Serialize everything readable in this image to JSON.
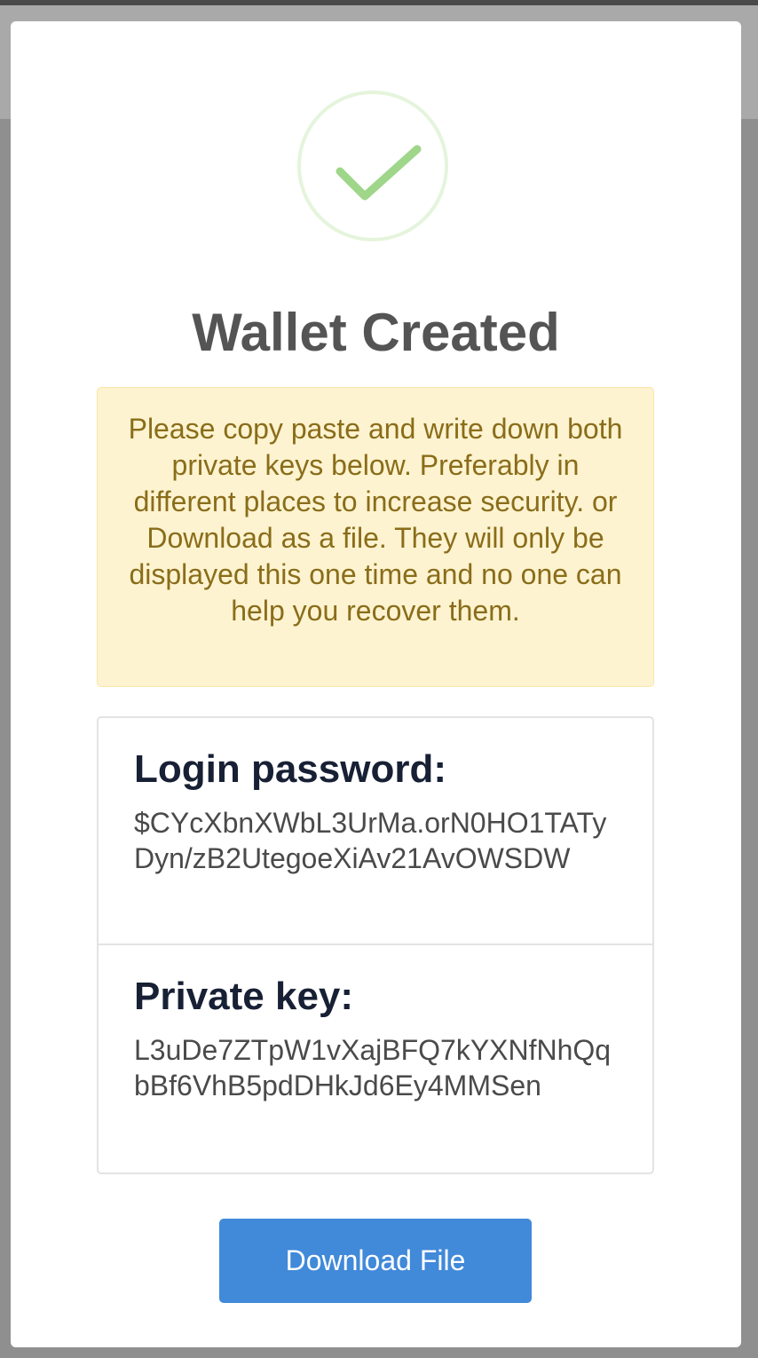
{
  "modal": {
    "title": "Wallet Created",
    "success_icon": "checkmark-icon",
    "warning_text": "Please copy paste and write down both private keys below. Preferably in different places to increase security. or Download as a file. They will only be displayed this one time and no one can help you recover them.",
    "login_password": {
      "label": "Login password:",
      "value": "$CYcXbnXWbL3UrMa.orN0HO1TATyDyn/zB2UtegoeXiAv21AvOWSDW"
    },
    "private_key": {
      "label": "Private key:",
      "value": "L3uDe7ZTpW1vXajBFQ7kYXNfNhQqbBf6VhB5pdDHkJd6Ey4MMSen"
    },
    "download_label": "Download File"
  },
  "colors": {
    "success_green": "#9fd68a",
    "warning_bg": "#fdf3d0",
    "warning_text": "#8a6d1a",
    "button_blue": "#4189d9"
  }
}
